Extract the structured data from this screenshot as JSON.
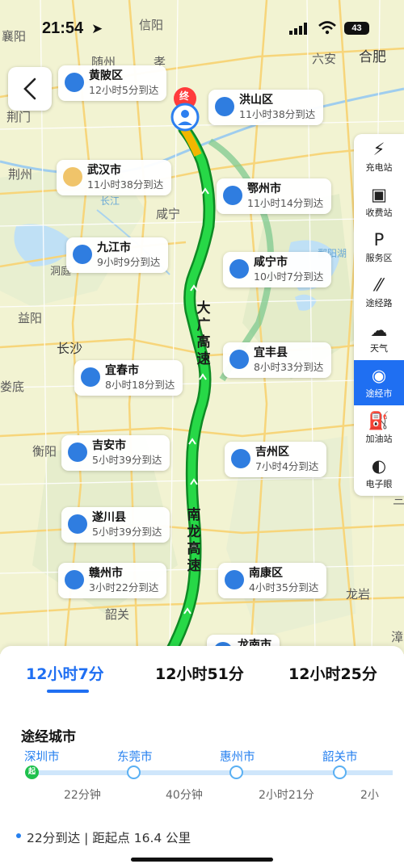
{
  "status_bar": {
    "time": "21:54",
    "battery": "43"
  },
  "map": {
    "places": [
      "襄阳",
      "信阳",
      "六安",
      "合肥",
      "荆门",
      "荆州",
      "咸宁",
      "长江",
      "益阳",
      "长沙",
      "衡阳",
      "韶关",
      "龙岩",
      "洞庭",
      "娄底",
      "鄱阳湖",
      "随州",
      "孝",
      "漳",
      "三"
    ],
    "roads": {
      "top_label": "大广高速",
      "bottom_label": "南龙高速"
    },
    "destination_marker": "终"
  },
  "cards": [
    {
      "name": "黄陂区",
      "time": "12小时5分到达"
    },
    {
      "name": "洪山区",
      "time": "11小时38分到达"
    },
    {
      "name": "武汉市",
      "time": "11小时38分到达"
    },
    {
      "name": "鄂州市",
      "time": "11小时14分到达"
    },
    {
      "name": "九江市",
      "time": "9小时9分到达"
    },
    {
      "name": "咸宁市",
      "time": "10小时7分到达"
    },
    {
      "name": "宜丰县",
      "time": "8小时33分到达"
    },
    {
      "name": "宜春市",
      "time": "8小时18分到达"
    },
    {
      "name": "吉安市",
      "time": "5小时39分到达"
    },
    {
      "name": "吉州区",
      "time": "7小时4分到达"
    },
    {
      "name": "遂川县",
      "time": "5小时39分到达"
    },
    {
      "name": "赣州市",
      "time": "3小时22分到达"
    },
    {
      "name": "南康区",
      "time": "4小时35分到达"
    },
    {
      "name": "龙南市",
      "time": ""
    }
  ],
  "toolbar": [
    {
      "label": "充电站",
      "icon": "charging-icon"
    },
    {
      "label": "收费站",
      "icon": "toll-icon"
    },
    {
      "label": "服务区",
      "icon": "service-area-icon"
    },
    {
      "label": "途经路",
      "icon": "road-icon"
    },
    {
      "label": "天气",
      "icon": "weather-icon"
    },
    {
      "label": "途经市",
      "icon": "city-icon"
    },
    {
      "label": "加油站",
      "icon": "gas-icon"
    },
    {
      "label": "电子眼",
      "icon": "camera-icon"
    }
  ],
  "routes": [
    "12小时7分",
    "12小时51分",
    "12小时25分"
  ],
  "via": {
    "title": "途经城市",
    "start_marker": "起",
    "cities": [
      "深圳市",
      "东莞市",
      "惠州市",
      "韶关市"
    ],
    "durations": [
      "22分钟",
      "40分钟",
      "2小时21分",
      "2小"
    ]
  },
  "summary": "22分到达 | 距起点 16.4 公里",
  "colors": {
    "accent": "#1f6ff2",
    "route": "#22c43a",
    "map_bg": "#f2f3d2"
  }
}
